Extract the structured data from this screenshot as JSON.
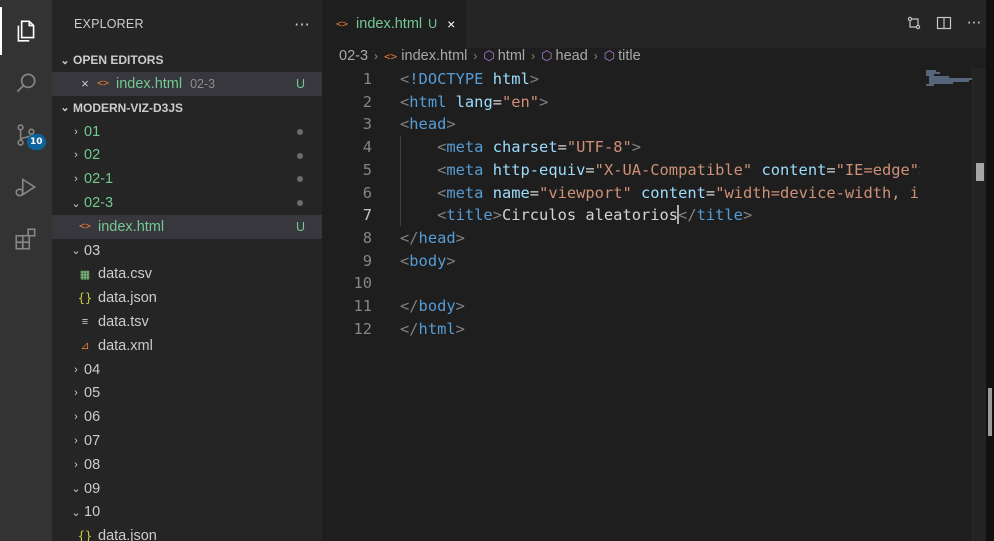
{
  "activity_bar": {
    "scm_badge": "10",
    "icons": [
      "explorer-icon",
      "search-icon",
      "source-control-icon",
      "run-debug-icon",
      "extensions-icon"
    ]
  },
  "sidebar": {
    "title": "EXPLORER",
    "more_label": "···",
    "open_editors": {
      "header": "OPEN EDITORS",
      "items": [
        {
          "name": "index.html",
          "folder": "02-3",
          "status": "U"
        }
      ]
    },
    "project": {
      "header": "MODERN-VIZ-D3JS",
      "items": [
        {
          "label": "01"
        },
        {
          "label": "02"
        },
        {
          "label": "02-1"
        },
        {
          "label": "02-3"
        },
        {
          "label": "index.html",
          "status": "U"
        },
        {
          "label": "03"
        },
        {
          "label": "data.csv"
        },
        {
          "label": "data.json"
        },
        {
          "label": "data.tsv"
        },
        {
          "label": "data.xml"
        },
        {
          "label": "04"
        },
        {
          "label": "05"
        },
        {
          "label": "06"
        },
        {
          "label": "07"
        },
        {
          "label": "08"
        },
        {
          "label": "09"
        },
        {
          "label": "10"
        },
        {
          "label": "data.json"
        }
      ]
    }
  },
  "tab": {
    "label": "index.html",
    "status": "U",
    "close": "×"
  },
  "breadcrumb": {
    "folder": "02-3",
    "file": "index.html",
    "s1": "html",
    "s2": "head",
    "s3": "title"
  },
  "editor": {
    "active_line": 7,
    "line_numbers": [
      "1",
      "2",
      "3",
      "4",
      "5",
      "6",
      "7",
      "8",
      "9",
      "10",
      "11",
      "12"
    ],
    "lines": [
      [
        [
          "p",
          "<"
        ],
        [
          "t",
          "!DOCTYPE"
        ],
        [
          "x",
          " "
        ],
        [
          "a",
          "html"
        ],
        [
          "p",
          ">"
        ]
      ],
      [
        [
          "p",
          "<"
        ],
        [
          "t",
          "html"
        ],
        [
          "x",
          " "
        ],
        [
          "a",
          "lang"
        ],
        [
          "x",
          "="
        ],
        [
          "s",
          "\"en\""
        ],
        [
          "p",
          ">"
        ]
      ],
      [
        [
          "p",
          "<"
        ],
        [
          "t",
          "head"
        ],
        [
          "p",
          ">"
        ]
      ],
      [
        [
          "x",
          "    "
        ],
        [
          "p",
          "<"
        ],
        [
          "t",
          "meta"
        ],
        [
          "x",
          " "
        ],
        [
          "a",
          "charset"
        ],
        [
          "x",
          "="
        ],
        [
          "s",
          "\"UTF-8\""
        ],
        [
          "p",
          ">"
        ]
      ],
      [
        [
          "x",
          "    "
        ],
        [
          "p",
          "<"
        ],
        [
          "t",
          "meta"
        ],
        [
          "x",
          " "
        ],
        [
          "a",
          "http-equiv"
        ],
        [
          "x",
          "="
        ],
        [
          "s",
          "\"X-UA-Compatible\""
        ],
        [
          "x",
          " "
        ],
        [
          "a",
          "content"
        ],
        [
          "x",
          "="
        ],
        [
          "s",
          "\"IE=edge\""
        ],
        [
          "p",
          ">"
        ]
      ],
      [
        [
          "x",
          "    "
        ],
        [
          "p",
          "<"
        ],
        [
          "t",
          "meta"
        ],
        [
          "x",
          " "
        ],
        [
          "a",
          "name"
        ],
        [
          "x",
          "="
        ],
        [
          "s",
          "\"viewport\""
        ],
        [
          "x",
          " "
        ],
        [
          "a",
          "content"
        ],
        [
          "x",
          "="
        ],
        [
          "s",
          "\"width=device-width, in"
        ]
      ],
      [
        [
          "x",
          "    "
        ],
        [
          "p",
          "<"
        ],
        [
          "t",
          "title"
        ],
        [
          "p",
          ">"
        ],
        [
          "x",
          "Circulos aleatorios"
        ],
        [
          "c",
          ""
        ],
        [
          "p",
          "</"
        ],
        [
          "t",
          "title"
        ],
        [
          "p",
          ">"
        ]
      ],
      [
        [
          "p",
          "</"
        ],
        [
          "t",
          "head"
        ],
        [
          "p",
          ">"
        ]
      ],
      [
        [
          "p",
          "<"
        ],
        [
          "t",
          "body"
        ],
        [
          "p",
          ">"
        ]
      ],
      [],
      [
        [
          "p",
          "</"
        ],
        [
          "t",
          "body"
        ],
        [
          "p",
          ">"
        ]
      ],
      [
        [
          "p",
          "</"
        ],
        [
          "t",
          "html"
        ],
        [
          "p",
          ">"
        ]
      ]
    ]
  }
}
